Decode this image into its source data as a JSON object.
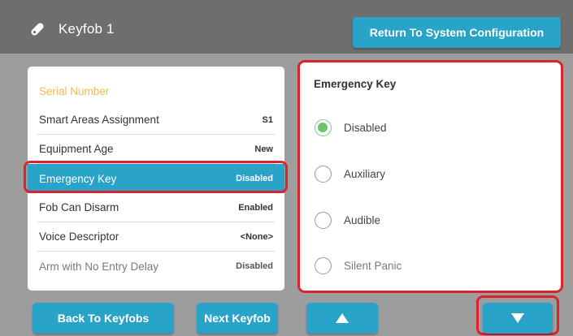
{
  "header": {
    "icon": "keyfob-icon",
    "title": "Keyfob 1",
    "return_label": "Return To System Configuration"
  },
  "list": {
    "header_label": "Serial Number",
    "rows": [
      {
        "label": "Smart Areas Assignment",
        "value": "S1"
      },
      {
        "label": "Equipment Age",
        "value": "New"
      },
      {
        "label": "Emergency Key",
        "value": "Disabled",
        "selected": true
      },
      {
        "label": "Fob Can Disarm",
        "value": "Enabled"
      },
      {
        "label": "Voice Descriptor",
        "value": "<None>"
      },
      {
        "label": "Arm with No Entry Delay",
        "value": "Disabled"
      }
    ]
  },
  "options": {
    "title": "Emergency Key",
    "items": [
      {
        "label": "Disabled",
        "checked": true
      },
      {
        "label": "Auxiliary",
        "checked": false
      },
      {
        "label": "Audible",
        "checked": false
      },
      {
        "label": "Silent Panic",
        "checked": false
      }
    ]
  },
  "footer": {
    "back_label": "Back To Keyfobs",
    "next_label": "Next Keyfob",
    "up_icon": "arrow-up-icon",
    "down_icon": "arrow-down-icon"
  },
  "colors": {
    "accent": "#2aa3c9",
    "highlight_outline": "#d9232d",
    "header_text": "#f5b94a",
    "radio_checked": "#6cc46a"
  }
}
